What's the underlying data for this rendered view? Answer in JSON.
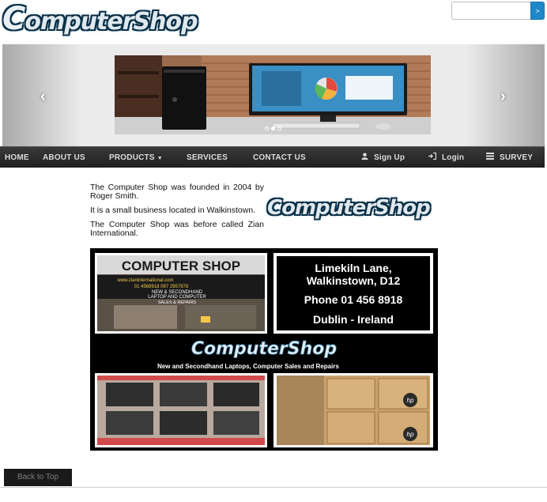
{
  "header": {
    "logo_text": "ComputerShop",
    "search": {
      "placeholder": "",
      "value": "",
      "button_label": ">"
    }
  },
  "carousel": {
    "prev_label": "‹",
    "next_label": "›",
    "slides": 3,
    "active_slide": 2
  },
  "nav": {
    "items": [
      {
        "label": "HOME"
      },
      {
        "label": "ABOUT US"
      },
      {
        "label": "PRODUCTS"
      },
      {
        "label": "SERVICES"
      },
      {
        "label": "CONTACT US"
      }
    ],
    "right_items": [
      {
        "label": "Sign Up",
        "icon": "user-icon"
      },
      {
        "label": "Login",
        "icon": "login-icon"
      },
      {
        "label": "SURVEY",
        "icon": "list-icon"
      }
    ]
  },
  "content": {
    "paragraphs": [
      "The Computer Shop was founded in 2004 by Roger Smith.",
      "It is a small business located in Walkinstown.",
      "The Computer Shop was before called Zian International."
    ],
    "side_logo_text": "ComputerShop"
  },
  "flyer": {
    "shop_sign": "COMPUTER SHOP",
    "shop_web": "www.zianinternational.com",
    "shop_phones": "01 4568918   087 2957978",
    "shop_line1": "NEW & SECONDHAND",
    "shop_line2": "LAPTOP AND COMPUTER",
    "shop_line3": "SALES & REPAIRS",
    "address_line1": "Limekiln Lane,",
    "address_line2": "Walkinstown, D12",
    "phone": "Phone 01 456 8918",
    "city": "Dublin - Ireland",
    "brand": "ComputerShop",
    "tagline": "New and Secondhand Laptops, Computer Sales and Repairs",
    "box_label": "hp"
  },
  "footer": {
    "back_to_top": "Back to Top"
  },
  "colors": {
    "nav_bg": "#2b2b2b",
    "search_btn": "#1e88c9",
    "logo_outline": "#0b2f45"
  }
}
